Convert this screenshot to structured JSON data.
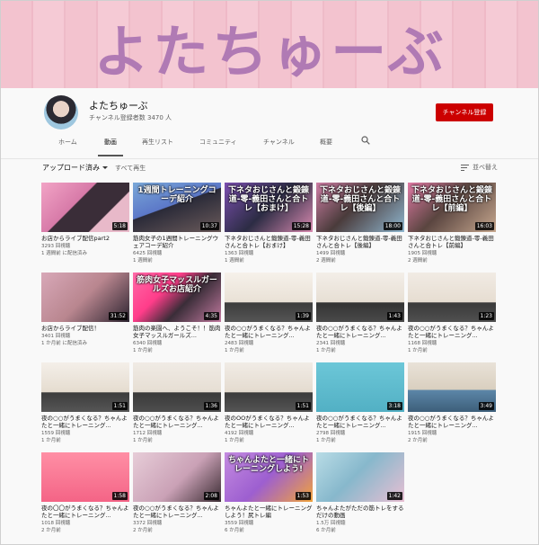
{
  "banner": {
    "title": "よたちゅーぶ",
    "bg_color": "#f3c3cf",
    "title_color": "#b07ab4"
  },
  "channel": {
    "name": "よたちゅーぶ",
    "subscribers": "チャンネル登録者数 3470 人",
    "subscribe_label": "チャンネル登録",
    "subscribe_color": "#cc0000"
  },
  "tabs": [
    {
      "label": "ホーム"
    },
    {
      "label": "動画"
    },
    {
      "label": "再生リスト"
    },
    {
      "label": "コミュニティ"
    },
    {
      "label": "チャンネル"
    },
    {
      "label": "概要"
    }
  ],
  "active_tab": "動画",
  "filter": {
    "selected": "アップロード済み",
    "play_all": "すべて再生",
    "sort_label": "並べ替え"
  },
  "videos": [
    {
      "title": "お店からライブ配信part2",
      "views": "3293 回視聴",
      "age": "1 週間前 に配信済み",
      "duration": "5:18",
      "thumb_text": ""
    },
    {
      "title": "筋肉女子の1週間トレーニングウェアコーデ紹介",
      "views": "6425 回視聴",
      "age": "1 週間前",
      "duration": "10:37",
      "thumb_text": "1週間トレーニングコーデ紹介"
    },
    {
      "title": "下ネタおじさんと鍛錬道-零-義田さんと合トレ【おまけ】",
      "views": "1363 回視聴",
      "age": "1 週間前",
      "duration": "15:28",
      "thumb_text": "下ネタおじさんと鍛錬道-零-義田さんと合トレ【おまけ】"
    },
    {
      "title": "下ネタおじさんと鍛錬道-零-義田さんと合トレ【後編】",
      "views": "1499 回視聴",
      "age": "2 週間前",
      "duration": "18:00",
      "thumb_text": "下ネタおじさんと鍛錬道-零-義田さんと合トレ【後編】"
    },
    {
      "title": "下ネタおじさんと鍛錬道-零-義田さんと合トレ【前編】",
      "views": "1905 回視聴",
      "age": "2 週間前",
      "duration": "16:03",
      "thumb_text": "下ネタおじさんと鍛錬道-零-義田さんと合トレ【前編】"
    },
    {
      "title": "お店からライブ配信！",
      "views": "3401 回視聴",
      "age": "1 か月前 に配信済み",
      "duration": "31:52",
      "thumb_text": ""
    },
    {
      "title": "筋肉の楽園へ、ようこそ！！筋肉女子マッスルガールズ...",
      "views": "6340 回視聴",
      "age": "1 か月前",
      "duration": "4:35",
      "thumb_text": "筋肉女子マッスルガールズお店紹介"
    },
    {
      "title": "夜の○○がうまくなる？ちゃんよたと一緒にトレーニング...",
      "views": "2483 回視聴",
      "age": "1 か月前",
      "duration": "1:39",
      "thumb_text": ""
    },
    {
      "title": "夜の○○がうまくなる？ちゃんよたと一緒にトレーニング...",
      "views": "2341 回視聴",
      "age": "1 か月前",
      "duration": "1:43",
      "thumb_text": ""
    },
    {
      "title": "夜の○○がうまくなる？ちゃんよたと一緒にトレーニング...",
      "views": "1168 回視聴",
      "age": "1 か月前",
      "duration": "1:23",
      "thumb_text": ""
    },
    {
      "title": "夜の○○がうまくなる？ちゃんよたと一緒にトレーニング...",
      "views": "1559 回視聴",
      "age": "1 か月前",
      "duration": "1:51",
      "thumb_text": ""
    },
    {
      "title": "夜の○○がうまくなる？ちゃんよたと一緒にトレーニング...",
      "views": "1712 回視聴",
      "age": "1 か月前",
      "duration": "1:36",
      "thumb_text": ""
    },
    {
      "title": "夜のOOがうまくなる？ちゃんよたと一緒にトレーニング...",
      "views": "4192 回視聴",
      "age": "1 か月前",
      "duration": "1:51",
      "thumb_text": ""
    },
    {
      "title": "夜の○○がうまくなる？ちゃんよたと一緒にトレーニング...",
      "views": "2798 回視聴",
      "age": "1 か月前",
      "duration": "3:18",
      "thumb_text": ""
    },
    {
      "title": "夜の○○がうまくなる？ちゃんよたと一緒にトレーニング...",
      "views": "1915 回視聴",
      "age": "2 か月前",
      "duration": "3:49",
      "thumb_text": ""
    },
    {
      "title": "夜の〇〇がうまくなる？ちゃんよたと一緒にトレーニング...",
      "views": "1018 回視聴",
      "age": "2 か月前",
      "duration": "1:58",
      "thumb_text": ""
    },
    {
      "title": "夜の○○がうまくなる？ちゃんよたと一緒にトレーニング...",
      "views": "3372 回視聴",
      "age": "2 か月前",
      "duration": "2:08",
      "thumb_text": ""
    },
    {
      "title": "ちゃんよたと一緒にトレーニングしよう！尻トレ編",
      "views": "3559 回視聴",
      "age": "6 か月前",
      "duration": "1:53",
      "thumb_text": "ちゃんよたと一緒にトレーニングしよう!"
    },
    {
      "title": "ちゃんよたがただの筋トレをするだけの動画",
      "views": "1.5万 回視聴",
      "age": "6 か月前",
      "duration": "1:42",
      "thumb_text": ""
    }
  ]
}
